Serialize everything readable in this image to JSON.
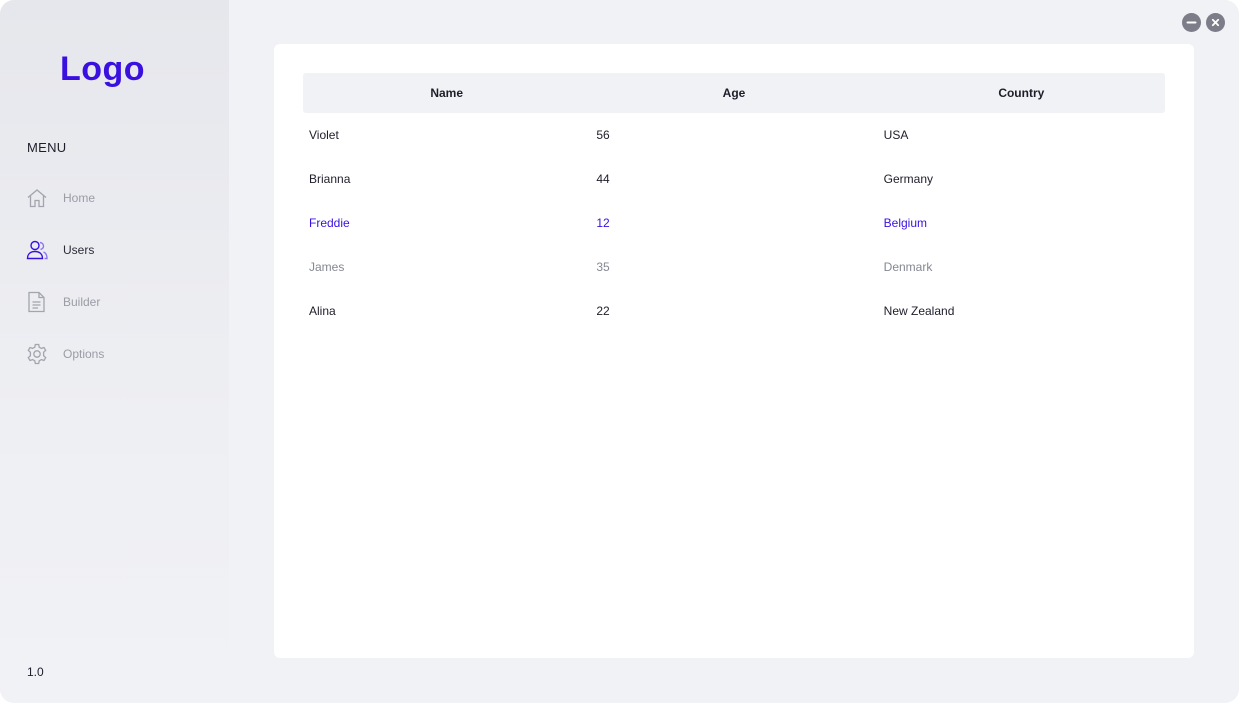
{
  "brand": {
    "logo_text": "Logo",
    "accent": "#3a10e0"
  },
  "sidebar": {
    "menu_heading": "MENU",
    "items": [
      {
        "label": "Home",
        "icon": "home-icon",
        "active": false
      },
      {
        "label": "Users",
        "icon": "users-icon",
        "active": true
      },
      {
        "label": "Builder",
        "icon": "document-icon",
        "active": false
      },
      {
        "label": "Options",
        "icon": "gear-icon",
        "active": false
      }
    ],
    "version": "1.0"
  },
  "window_controls": {
    "minimize": "minimize-icon",
    "close": "close-icon"
  },
  "table": {
    "columns": [
      "Name",
      "Age",
      "Country"
    ],
    "rows": [
      {
        "name": "Violet",
        "age": "56",
        "country": "USA",
        "state": "normal"
      },
      {
        "name": "Brianna",
        "age": "44",
        "country": "Germany",
        "state": "normal"
      },
      {
        "name": "Freddie",
        "age": "12",
        "country": "Belgium",
        "state": "selected"
      },
      {
        "name": "James",
        "age": "35",
        "country": "Denmark",
        "state": "muted"
      },
      {
        "name": "Alina",
        "age": "22",
        "country": "New Zealand",
        "state": "normal"
      }
    ]
  }
}
